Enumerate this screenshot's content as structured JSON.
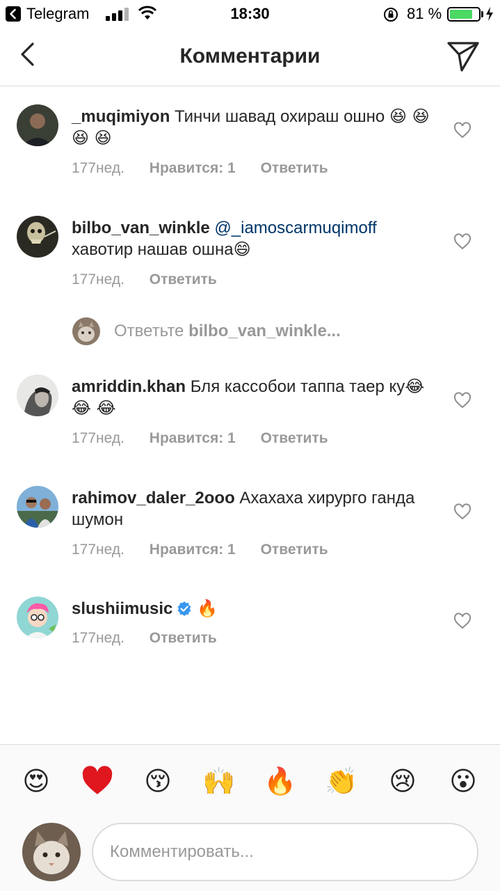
{
  "status_bar": {
    "back_app": "Telegram",
    "time": "18:30",
    "battery_percent": "81 %",
    "battery_level": 0.81,
    "colors": {
      "battery": "#4cd964"
    }
  },
  "nav": {
    "title": "Комментарии",
    "back_icon": "chevron-left-icon",
    "send_icon": "paper-plane-icon"
  },
  "comments": [
    {
      "username": "_muqimiyon",
      "text": "Тинчи шавад охираш ошно",
      "emoji": "😆 😆 😆 😆",
      "time": "177нед.",
      "likes": "Нравится: 1",
      "reply": "Ответить"
    },
    {
      "username": "bilbo_van_winkle",
      "mention": "@_iamoscarmuqimoff",
      "text": "хавотир нашав ошна",
      "emoji": "😄",
      "time": "177нед.",
      "reply": "Ответить"
    },
    {
      "username": "amriddin.khan",
      "text": "Бля кассобои таппа таер ку",
      "emoji": "😂 😂 😂",
      "time": "177нед.",
      "likes": "Нравится: 1",
      "reply": "Ответить"
    },
    {
      "username": "rahimov_daler_2ooo",
      "text": "Ахахаха хирурго ганда шумон",
      "time": "177нед.",
      "likes": "Нравится: 1",
      "reply": "Ответить"
    },
    {
      "username": "slushiimusic",
      "verified": true,
      "emoji": "🔥",
      "time": "177нед.",
      "reply": "Ответить"
    }
  ],
  "reply_prompt": {
    "prefix": "Ответьте",
    "username": "bilbo_van_winkle..."
  },
  "quick_emojis": [
    "😍",
    "❤️",
    "😚",
    "🙌",
    "🔥",
    "👏",
    "😢",
    "😮"
  ],
  "composer": {
    "placeholder": "Комментировать..."
  },
  "colors": {
    "text": "#262626",
    "meta": "#999999",
    "mention": "#003569",
    "divider": "#dbdbdb",
    "verified": "#3897f0"
  }
}
